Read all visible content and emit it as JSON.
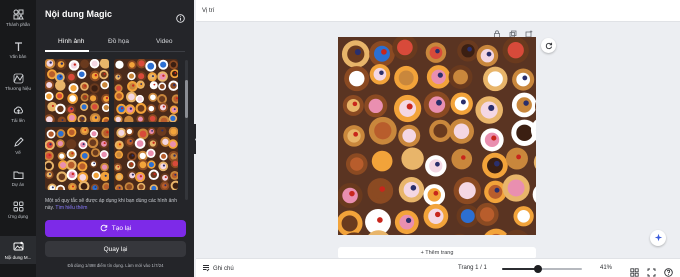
{
  "rail": [
    {
      "label": "Thành phần",
      "icon": "elements-icon"
    },
    {
      "label": "Văn bản",
      "icon": "text-icon"
    },
    {
      "label": "Thương hiệu",
      "icon": "brand-icon"
    },
    {
      "label": "Tải lên",
      "icon": "upload-icon"
    },
    {
      "label": "Vẽ",
      "icon": "draw-icon"
    },
    {
      "label": "Dự án",
      "icon": "projects-icon"
    },
    {
      "label": "Ứng dụng",
      "icon": "apps-icon"
    },
    {
      "label": "Nội dung M...",
      "icon": "magic-media-icon",
      "active": true
    }
  ],
  "panel": {
    "title": "Nội dung Magic",
    "tabs": [
      {
        "label": "Hình ảnh",
        "active": true
      },
      {
        "label": "Đồ họa"
      },
      {
        "label": "Video"
      }
    ],
    "notice_text": "Một số quy tắc sẽ được áp dụng khi bạn dùng các hình ảnh này.",
    "notice_link": "Tìm hiểu thêm",
    "create_button": "Tạo lại",
    "back_button": "Quay lại",
    "footnote": "Đã dùng 1/498 điểm tín dụng. Làm mới vào 1/7/24"
  },
  "canvas": {
    "position_label": "Vị trí",
    "add_page_label": "+ Thêm trang"
  },
  "bottombar": {
    "notes_label": "Ghi chú",
    "page_indicator": "Trang 1 / 1",
    "zoom_label": "41%",
    "zoom_fraction": 0.41
  },
  "colors": {
    "accent": "#7d2ae8",
    "panel_bg": "#242529",
    "rail_bg": "#18191b",
    "workspace_bg": "#eceef2",
    "wood": "#5a3422"
  }
}
